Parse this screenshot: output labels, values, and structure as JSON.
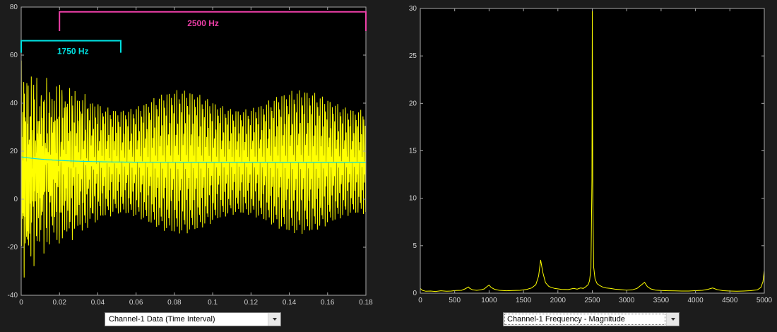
{
  "window": {
    "background": "#1c1c1c"
  },
  "left_panel": {
    "dropdown": {
      "value": "Channel-1 Data (Time Interval)"
    }
  },
  "right_panel": {
    "dropdown": {
      "value": "Channel-1 Frequency - Magnitude"
    }
  },
  "chart_data": [
    {
      "type": "line",
      "name": "time-domain",
      "title": "",
      "xlabel": "",
      "ylabel": "",
      "xlim": [
        0,
        0.18
      ],
      "ylim": [
        -40,
        80
      ],
      "xtick_vals": [
        0,
        0.02,
        0.04,
        0.06,
        0.08,
        0.1,
        0.12,
        0.14,
        0.16,
        0.18
      ],
      "xtick_labels": [
        "0",
        "0.02",
        "0.04",
        "0.06",
        "0.08",
        "0.1",
        "0.12",
        "0.14",
        "0.16",
        "0.18"
      ],
      "ytick_vals": [
        -40,
        -20,
        0,
        20,
        40,
        60,
        80
      ],
      "ytick_labels": [
        "-40",
        "-20",
        "0",
        "20",
        "40",
        "60",
        "80"
      ],
      "grid": false,
      "legend": "none",
      "background": "#000000",
      "axis_color": "#a8a8a8",
      "tick_label_color": "#d2d2d2",
      "series": [
        {
          "name": "channel-1-signal",
          "color": "#ffff00",
          "width": 1,
          "synth": {
            "samples": 4200,
            "offset": 15.5,
            "components": [
              {
                "freq": 1750,
                "amp": 13
              },
              {
                "freq": 2500,
                "amp": 13
              }
            ],
            "env_mod": {
              "freq": 16,
              "depth": 0.16,
              "phase": -0.49
            },
            "transient": {
              "amp": 26,
              "freq": 3100,
              "decay": 0.012,
              "offset_shift": -5,
              "offset_decay": 0.012
            }
          }
        },
        {
          "name": "running-mean",
          "color": "#00e0e0",
          "width": 1.2,
          "decay_line": {
            "offset": 15.3,
            "start_extra": 2.3,
            "decay": 0.02,
            "samples": 240
          }
        }
      ],
      "annotations": [
        {
          "label": "1750 Hz",
          "color": "#00e0e0",
          "x0": 0.0,
          "x1": 0.052,
          "y": 66,
          "tick_drop": 5,
          "label_x": 0.027,
          "label_y": 60.5
        },
        {
          "label": "2500 Hz",
          "color": "#ee3fa8",
          "x0": 0.02,
          "x1": 0.18,
          "y": 78,
          "tick_drop": 8,
          "label_x": 0.095,
          "label_y": 72
        }
      ]
    },
    {
      "type": "line",
      "name": "frequency-domain",
      "title": "",
      "xlabel": "",
      "ylabel": "",
      "xlim": [
        0,
        5000
      ],
      "ylim": [
        0,
        30
      ],
      "xtick_vals": [
        0,
        500,
        1000,
        1500,
        2000,
        2500,
        3000,
        3500,
        4000,
        4500,
        5000
      ],
      "xtick_labels": [
        "0",
        "500",
        "1000",
        "1500",
        "2000",
        "2500",
        "3000",
        "3500",
        "4000",
        "4500",
        "5000"
      ],
      "ytick_vals": [
        0,
        5,
        10,
        15,
        20,
        25,
        30
      ],
      "ytick_labels": [
        "0",
        "5",
        "10",
        "15",
        "20",
        "25",
        "30"
      ],
      "grid": false,
      "legend": "none",
      "background": "#000000",
      "axis_color": "#a8a8a8",
      "tick_label_color": "#d2d2d2",
      "peaks_of_interest": [
        {
          "freq": 1750,
          "magnitude": 3.5
        },
        {
          "freq": 2500,
          "magnitude": 29.8
        }
      ],
      "series": [
        {
          "name": "channel-1-magnitude",
          "color": "#ffff00",
          "width": 1,
          "points": [
            [
              0,
              0.5
            ],
            [
              30,
              0.3
            ],
            [
              80,
              0.2
            ],
            [
              150,
              0.22
            ],
            [
              220,
              0.18
            ],
            [
              300,
              0.25
            ],
            [
              380,
              0.2
            ],
            [
              450,
              0.22
            ],
            [
              520,
              0.28
            ],
            [
              600,
              0.3
            ],
            [
              650,
              0.45
            ],
            [
              700,
              0.65
            ],
            [
              720,
              0.5
            ],
            [
              760,
              0.35
            ],
            [
              820,
              0.3
            ],
            [
              880,
              0.35
            ],
            [
              930,
              0.45
            ],
            [
              970,
              0.7
            ],
            [
              1000,
              0.85
            ],
            [
              1030,
              0.6
            ],
            [
              1080,
              0.4
            ],
            [
              1150,
              0.3
            ],
            [
              1250,
              0.25
            ],
            [
              1350,
              0.28
            ],
            [
              1450,
              0.3
            ],
            [
              1550,
              0.4
            ],
            [
              1620,
              0.55
            ],
            [
              1680,
              0.9
            ],
            [
              1720,
              1.8
            ],
            [
              1750,
              3.5
            ],
            [
              1780,
              2.2
            ],
            [
              1820,
              1.1
            ],
            [
              1870,
              0.7
            ],
            [
              1950,
              0.5
            ],
            [
              2050,
              0.4
            ],
            [
              2150,
              0.38
            ],
            [
              2230,
              0.5
            ],
            [
              2280,
              0.42
            ],
            [
              2330,
              0.55
            ],
            [
              2370,
              0.5
            ],
            [
              2410,
              0.7
            ],
            [
              2440,
              0.9
            ],
            [
              2460,
              1.3
            ],
            [
              2480,
              2.6
            ],
            [
              2495,
              12
            ],
            [
              2500,
              29.8
            ],
            [
              2508,
              10
            ],
            [
              2520,
              2.8
            ],
            [
              2540,
              1.5
            ],
            [
              2570,
              1.0
            ],
            [
              2610,
              0.8
            ],
            [
              2650,
              0.65
            ],
            [
              2700,
              0.55
            ],
            [
              2760,
              0.5
            ],
            [
              2830,
              0.42
            ],
            [
              2900,
              0.38
            ],
            [
              3000,
              0.32
            ],
            [
              3080,
              0.35
            ],
            [
              3150,
              0.5
            ],
            [
              3220,
              0.9
            ],
            [
              3260,
              1.15
            ],
            [
              3300,
              0.7
            ],
            [
              3350,
              0.45
            ],
            [
              3420,
              0.32
            ],
            [
              3500,
              0.28
            ],
            [
              3600,
              0.25
            ],
            [
              3700,
              0.24
            ],
            [
              3800,
              0.22
            ],
            [
              3900,
              0.22
            ],
            [
              4000,
              0.26
            ],
            [
              4100,
              0.3
            ],
            [
              4180,
              0.4
            ],
            [
              4250,
              0.55
            ],
            [
              4310,
              0.38
            ],
            [
              4400,
              0.26
            ],
            [
              4500,
              0.22
            ],
            [
              4600,
              0.2
            ],
            [
              4700,
              0.22
            ],
            [
              4800,
              0.26
            ],
            [
              4900,
              0.35
            ],
            [
              4950,
              0.6
            ],
            [
              4980,
              1.2
            ],
            [
              5000,
              2.4
            ]
          ]
        }
      ],
      "annotations": []
    }
  ]
}
